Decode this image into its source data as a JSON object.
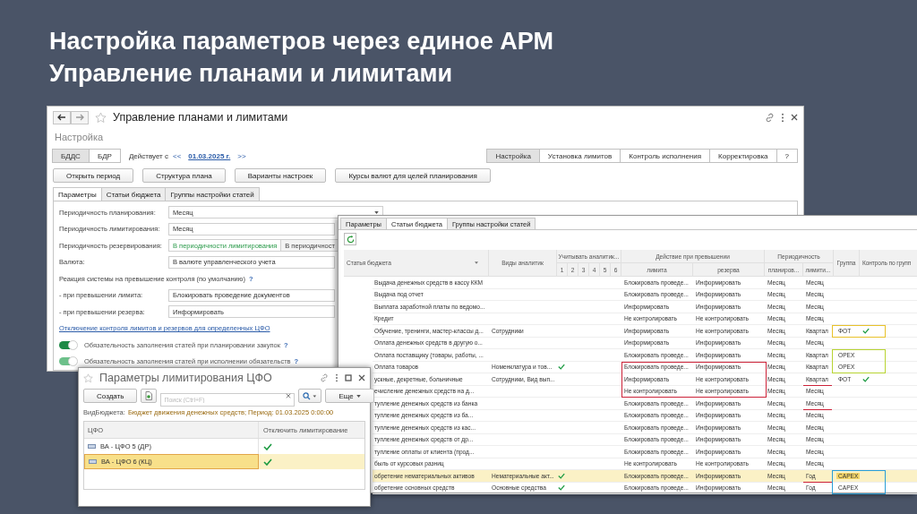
{
  "slide_title": [
    "Настройка параметров через единое АРМ",
    "Управление планами и лимитами"
  ],
  "main_window": {
    "title": "Управление планами и лимитами",
    "subtitle": "Настройка",
    "budget_types": [
      {
        "label": "БДДС",
        "selected": true
      },
      {
        "label": "БДР",
        "selected": false
      }
    ],
    "effective_label": "Действует с",
    "prev": "<<",
    "date": "01.03.2025 г.",
    "next": ">>",
    "mode_tabs": [
      {
        "label": "Настройка",
        "selected": true
      },
      {
        "label": "Установка лимитов",
        "selected": false
      },
      {
        "label": "Контроль исполнения",
        "selected": false
      },
      {
        "label": "Корректировка",
        "selected": false
      }
    ],
    "help": "?",
    "buttons": [
      "Открыть период",
      "Структура плана",
      "Варианты настроек",
      "Курсы валют для целей планирования"
    ],
    "tabs": [
      {
        "label": "Параметры",
        "selected": true
      },
      {
        "label": "Статьи бюджета",
        "selected": false
      },
      {
        "label": "Группы настройки статей",
        "selected": false
      }
    ],
    "form": [
      {
        "kind": "select",
        "label": "Периодичность планирования:",
        "value": "Месяц"
      },
      {
        "kind": "field",
        "label": "Периодичность лимитирования:",
        "value": "Месяц"
      },
      {
        "kind": "choice",
        "label": "Периодичность резервирования:",
        "options": [
          {
            "label": "В периодичности лимитирования",
            "selected": true
          },
          {
            "label": "В периодичност",
            "selected": false
          }
        ]
      },
      {
        "kind": "field",
        "label": "Валюта:",
        "value": "В валюте управленческого учета"
      },
      {
        "kind": "heading",
        "label": "Реакция системы на превышение контроля (по умолчанию)",
        "help": "?"
      },
      {
        "kind": "field",
        "label": "- при превышении лимита:",
        "value": "Блокировать проведение документов"
      },
      {
        "kind": "field",
        "label": "- при превышении резерва:",
        "value": "Информировать"
      },
      {
        "kind": "link",
        "label": "Отключение контроля лимитов и резервов для определенных ЦФО"
      },
      {
        "kind": "toggle",
        "label": "Обязательность заполнения статей при планировании закупок",
        "on": true,
        "disabled": false,
        "help": "?"
      },
      {
        "kind": "toggle",
        "label": "Обязательность заполнения статей при исполнении обязательств",
        "on": true,
        "disabled": true,
        "help": "?"
      }
    ]
  },
  "articles_window": {
    "tabs": [
      {
        "label": "Параметры",
        "selected": false
      },
      {
        "label": "Статьи бюджета",
        "selected": true
      },
      {
        "label": "Группы настройки статей",
        "selected": false
      }
    ],
    "table": {
      "columns": {
        "article": "Статья бюджета",
        "analytics": "Виды аналитик",
        "consider": "Учитывать аналитик...",
        "consider_subs": [
          "1",
          "2",
          "3",
          "4",
          "5",
          "6"
        ],
        "action": "Действие при превышении",
        "limit": "лимита",
        "reserve": "резерва",
        "periodicity": "Периодичность",
        "plan": "планиров...",
        "limit_period": "лимити...",
        "group": "Группа",
        "group_control": "Контроль по групп"
      },
      "rows": [
        {
          "article": "Выдача денежных средств в кассу ККМ",
          "checks": [
            false,
            false,
            false,
            false,
            false,
            false
          ],
          "limit": "Блокировать проведе...",
          "reserve": "Информировать",
          "plan": "Месяц",
          "limit_period": "Месяц",
          "group_check": false,
          "limit_frame": false,
          "period_underline": false,
          "selected": false
        },
        {
          "article": "Выдача под отчет",
          "checks": [
            false,
            false,
            false,
            false,
            false,
            false
          ],
          "limit": "Блокировать проведе...",
          "reserve": "Информировать",
          "plan": "Месяц",
          "limit_period": "Месяц",
          "group_check": false,
          "limit_frame": false,
          "period_underline": false,
          "selected": false
        },
        {
          "article": "Выплата заработной платы по ведомо...",
          "checks": [
            false,
            false,
            false,
            false,
            false,
            false
          ],
          "limit": "Информировать",
          "reserve": "Информировать",
          "plan": "Месяц",
          "limit_period": "Месяц",
          "group_check": false,
          "limit_frame": false,
          "period_underline": false,
          "selected": false
        },
        {
          "article": "Кредит",
          "checks": [
            false,
            false,
            false,
            false,
            false,
            false
          ],
          "limit": "Не контролировать",
          "reserve": "Не контролировать",
          "plan": "Месяц",
          "limit_period": "Месяц",
          "group_check": false,
          "limit_frame": false,
          "period_underline": false,
          "selected": false
        },
        {
          "article": "Обучение, тренинги, мастер-классы д...",
          "analytics": "Сотрудники",
          "checks": [
            false,
            false,
            false,
            false,
            false,
            false
          ],
          "limit": "Информировать",
          "reserve": "Не контролировать",
          "plan": "Месяц",
          "limit_period": "Квартал",
          "group": "ФОТ",
          "group_selected": false,
          "group_check": true,
          "limit_frame": false,
          "color": "#e8c22a",
          "period_underline": false,
          "selected": false
        },
        {
          "article": "Оплата денежных средств в другую о...",
          "checks": [
            false,
            false,
            false,
            false,
            false,
            false
          ],
          "limit": "Информировать",
          "reserve": "Информировать",
          "plan": "Месяц",
          "limit_period": "Месяц",
          "group_check": false,
          "limit_frame": false,
          "period_underline": false,
          "selected": false
        },
        {
          "article": "Оплата поставщику (товары, работы, ...",
          "checks": [
            false,
            false,
            false,
            false,
            false,
            false
          ],
          "limit": "Блокировать проведе...",
          "reserve": "Информировать",
          "plan": "Месяц",
          "limit_period": "Квартал",
          "group": "OPEX",
          "group_selected": false,
          "group_check": false,
          "limit_frame": false,
          "color": "#b8d432",
          "period_underline": false,
          "selected": false
        },
        {
          "article": "Оплата товаров",
          "analytics": "Номенклатура и тов...",
          "checks": [
            true,
            false,
            false,
            false,
            false,
            false
          ],
          "limit": "Блокировать проведе...",
          "reserve": "Информировать",
          "plan": "Месяц",
          "limit_period": "Квартал",
          "group": "OPEX",
          "group_selected": false,
          "group_check": false,
          "limit_frame": true,
          "color": "#b8d432",
          "period_underline": false,
          "selected": false
        },
        {
          "article": "ускные, декретные, больничные",
          "analytics": "Сотрудники, Вид вып...",
          "checks": [
            false,
            false,
            false,
            false,
            false,
            false
          ],
          "limit": "Информировать",
          "reserve": "Не контролировать",
          "plan": "Месяц",
          "limit_period": "Квартал",
          "group": "ФОТ",
          "group_selected": false,
          "group_check": true,
          "limit_frame": true,
          "period_underline": true,
          "selected": false
        },
        {
          "article": "ечисление денежных средств на д...",
          "checks": [
            false,
            false,
            false,
            false,
            false,
            false
          ],
          "limit": "Не контролировать",
          "reserve": "Не контролировать",
          "plan": "Месяц",
          "limit_period": "Месяц",
          "group_check": false,
          "limit_frame": true,
          "period_underline": false,
          "selected": false
        },
        {
          "article": "тупление денежных средств из банка",
          "checks": [
            false,
            false,
            false,
            false,
            false,
            false
          ],
          "limit": "Блокировать проведе...",
          "reserve": "Информировать",
          "plan": "Месяц",
          "limit_period": "Месяц",
          "group_check": false,
          "limit_frame": false,
          "period_underline": true,
          "selected": false
        },
        {
          "article": "тупление денежных средств из ба...",
          "checks": [
            false,
            false,
            false,
            false,
            false,
            false
          ],
          "limit": "Блокировать проведе...",
          "reserve": "Информировать",
          "plan": "Месяц",
          "limit_period": "Месяц",
          "group_check": false,
          "limit_frame": false,
          "period_underline": false,
          "selected": false
        },
        {
          "article": "тупление денежных средств из кас...",
          "checks": [
            false,
            false,
            false,
            false,
            false,
            false
          ],
          "limit": "Блокировать проведе...",
          "reserve": "Информировать",
          "plan": "Месяц",
          "limit_period": "Месяц",
          "group_check": false,
          "limit_frame": false,
          "period_underline": false,
          "selected": false
        },
        {
          "article": "тупление денежных средств от др...",
          "checks": [
            false,
            false,
            false,
            false,
            false,
            false
          ],
          "limit": "Блокировать проведе...",
          "reserve": "Информировать",
          "plan": "Месяц",
          "limit_period": "Месяц",
          "group_check": false,
          "limit_frame": false,
          "period_underline": false,
          "selected": false
        },
        {
          "article": "тупление оплаты от клиента (прод...",
          "checks": [
            false,
            false,
            false,
            false,
            false,
            false
          ],
          "limit": "Блокировать проведе...",
          "reserve": "Информировать",
          "plan": "Месяц",
          "limit_period": "Месяц",
          "group_check": false,
          "limit_frame": false,
          "period_underline": false,
          "selected": false
        },
        {
          "article": "быль от курсовых разниц",
          "checks": [
            false,
            false,
            false,
            false,
            false,
            false
          ],
          "limit": "Не контролировать",
          "reserve": "Не контролировать",
          "plan": "Месяц",
          "limit_period": "Месяц",
          "group_check": false,
          "limit_frame": false,
          "period_underline": false,
          "selected": false
        },
        {
          "article": "обретение нематериальных активов",
          "analytics": "Нематериальные акт...",
          "checks": [
            true,
            false,
            false,
            false,
            false,
            false
          ],
          "limit": "Блокировать проведе...",
          "reserve": "Информировать",
          "plan": "Месяц",
          "limit_period": "Год",
          "group": "CAPEX",
          "group_selected": true,
          "group_check": false,
          "limit_frame": false,
          "color": "#2a9ed6",
          "period_underline": true,
          "selected": true
        },
        {
          "article": "обретение основных средств",
          "analytics": "Основные средства",
          "checks": [
            true,
            false,
            false,
            false,
            false,
            false
          ],
          "limit": "Блокировать проведе...",
          "reserve": "Информировать",
          "plan": "Месяц",
          "limit_period": "Год",
          "group": "CAPEX",
          "group_selected": false,
          "group_check": false,
          "limit_frame": false,
          "color": "#2a9ed6",
          "period_underline": false,
          "selected": false
        }
      ]
    }
  },
  "cfo_window": {
    "title": "Параметры лимитирования ЦФО",
    "create": "Создать",
    "search": {
      "placeholder": "Поиск (Ctrl+F)"
    },
    "more": "Еще",
    "info_label": "ВидБюджета:",
    "info_value": "Бюджет движения денежных средств; Период: 01.03.2025 0:00:00",
    "columns": [
      "ЦФО",
      "Отключить лимитирование"
    ],
    "rows": [
      {
        "name": "ВА - ЦФО 5 (ДР)",
        "disabled_limit": true,
        "selected": false
      },
      {
        "name": "ВА - ЦФО 6 (КЦ)",
        "disabled_limit": true,
        "selected": true
      }
    ]
  }
}
